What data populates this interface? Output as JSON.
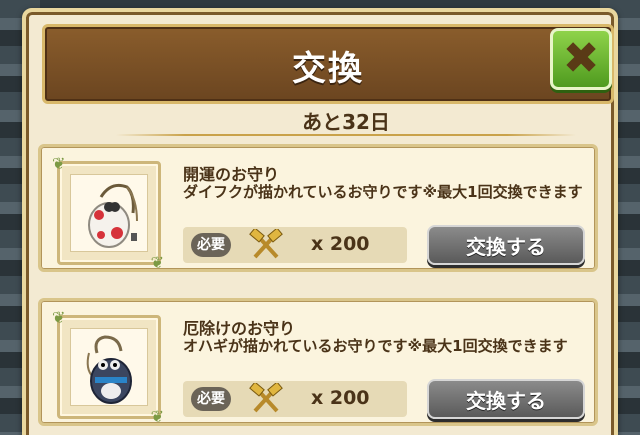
{
  "dialog": {
    "title": "交換",
    "close_icon": "close-x-icon",
    "remaining": "あと32日"
  },
  "items": [
    {
      "name": "開運のお守り",
      "description": "ダイフクが描かれているお守りです※最大1回交換できます",
      "required_label": "必要",
      "currency_icon": "crossed-hammers-icon",
      "quantity": "x 200",
      "button_label": "交換する",
      "charm_color": "#f2f2f2",
      "accent": "#d6323a"
    },
    {
      "name": "厄除けのお守り",
      "description": "オハギが描かれているお守りです※最大1回交換できます",
      "required_label": "必要",
      "currency_icon": "crossed-hammers-icon",
      "quantity": "x 200",
      "button_label": "交換する",
      "charm_color": "#3b4660",
      "accent": "#2a84c8"
    }
  ]
}
